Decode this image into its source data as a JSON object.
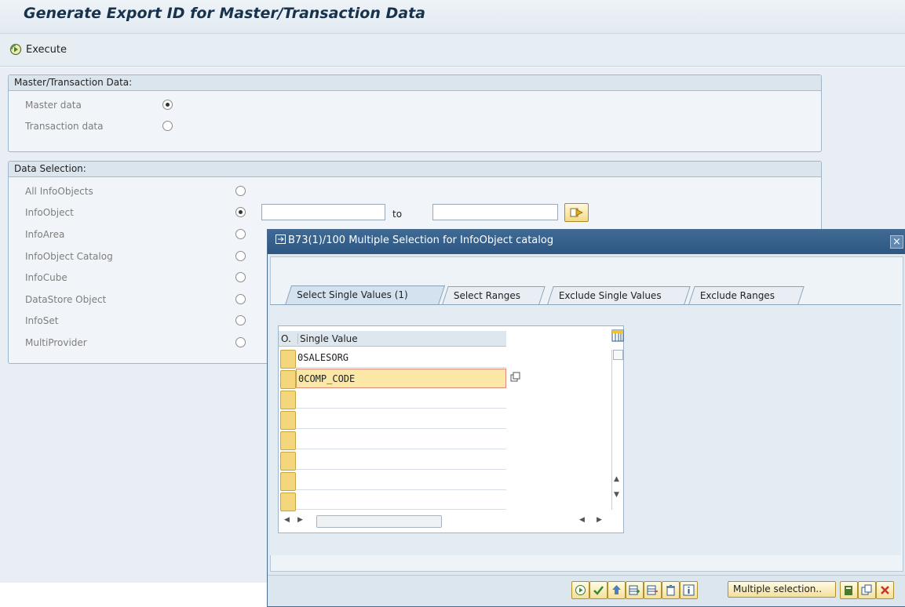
{
  "title": "Generate Export ID for Master/Transaction Data",
  "toolbar": {
    "execute_label": "Execute"
  },
  "group_master_transaction": {
    "header": "Master/Transaction Data:",
    "options": [
      {
        "label": "Master data",
        "selected": true
      },
      {
        "label": "Transaction data",
        "selected": false
      }
    ]
  },
  "group_data_selection": {
    "header": "Data Selection:",
    "options": [
      {
        "label": "All InfoObjects",
        "selected": false
      },
      {
        "label": "InfoObject",
        "selected": true
      },
      {
        "label": "InfoArea",
        "selected": false
      },
      {
        "label": "InfoObject Catalog",
        "selected": false
      },
      {
        "label": "InfoCube",
        "selected": false
      },
      {
        "label": "DataStore Object",
        "selected": false
      },
      {
        "label": "InfoSet",
        "selected": false
      },
      {
        "label": "MultiProvider",
        "selected": false
      }
    ],
    "range_to_label": "to",
    "from_value": "",
    "to_value": ""
  },
  "dialog": {
    "title": "B73(1)/100 Multiple Selection for InfoObject catalog",
    "tabs": [
      {
        "label": "Select Single Values (1)",
        "active": true
      },
      {
        "label": "Select Ranges",
        "active": false
      },
      {
        "label": "Exclude Single Values",
        "active": false
      },
      {
        "label": "Exclude Ranges",
        "active": false
      }
    ],
    "table": {
      "col_option": "O.",
      "col_single_value": "Single Value",
      "rows": [
        "0SALESORG",
        "0COMP_CODE",
        "",
        "",
        "",
        "",
        "",
        ""
      ]
    },
    "footer": {
      "multiple_selection_label": "Multiple selection.."
    }
  },
  "colors": {
    "accent": "#2d5782",
    "yellow_button": "#f4e09a"
  }
}
